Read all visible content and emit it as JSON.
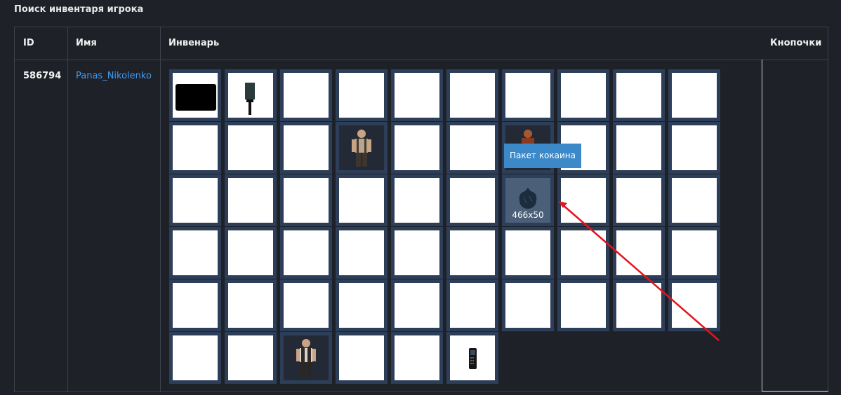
{
  "panel": {
    "title": "Поиск инвентаря игрока"
  },
  "table": {
    "headers": {
      "id": "ID",
      "name": "Имя",
      "inventory": "Инвенарь",
      "buttons": "Кнопочки"
    },
    "row": {
      "id": "586794",
      "name": "Panas_Nikolenko"
    }
  },
  "inventory": {
    "tooltip": "Пакет кокаина",
    "highlight_label": "466x50"
  },
  "colors": {
    "background": "#1f2128",
    "cell_frame": "#2c3e58",
    "link": "#3d9bf0",
    "tooltip": "#3c89c9",
    "arrow": "#e5141d"
  }
}
